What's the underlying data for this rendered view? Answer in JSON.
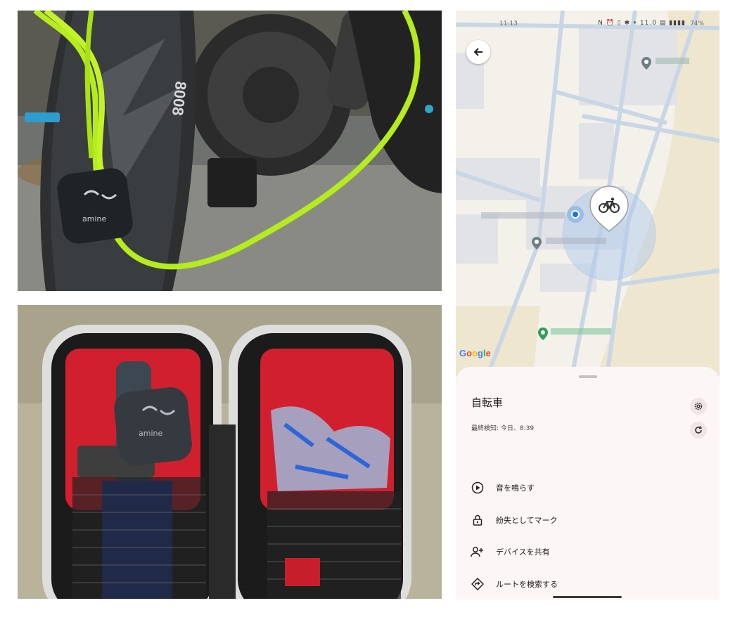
{
  "photos": {
    "top_tag_brand": "amine",
    "bottom_tag_brand": "amine"
  },
  "phone": {
    "status_bar": {
      "time": "11:13",
      "icons": "N ⏰ ▯ ✱ ⌖ 11.0 ▤ ▮▮▮▮",
      "battery": "74%"
    },
    "map": {
      "google_logo": [
        "G",
        "o",
        "o",
        "g",
        "l",
        "e"
      ],
      "device_icon": "bicycle-icon",
      "colors": {
        "road": "#c9d6e6",
        "land": "#f4f1ea",
        "block": "#e2e3e6",
        "sand": "#eee6cf",
        "accuracy": "#aac8ef",
        "pin_grey": "#6f7f86",
        "pin_green": "#2e9e5b",
        "my_location": "#1a73e8"
      }
    },
    "sheet": {
      "device_name": "自転車",
      "last_seen": "最終検知: 今日、8:39",
      "actions": [
        {
          "label": "音を鳴らす",
          "icon": "play-circle-icon"
        },
        {
          "label": "紛失としてマーク",
          "icon": "lock-icon"
        },
        {
          "label": "デバイスを共有",
          "icon": "person-add-icon"
        },
        {
          "label": "ルートを検索する",
          "icon": "directions-icon"
        }
      ]
    }
  }
}
